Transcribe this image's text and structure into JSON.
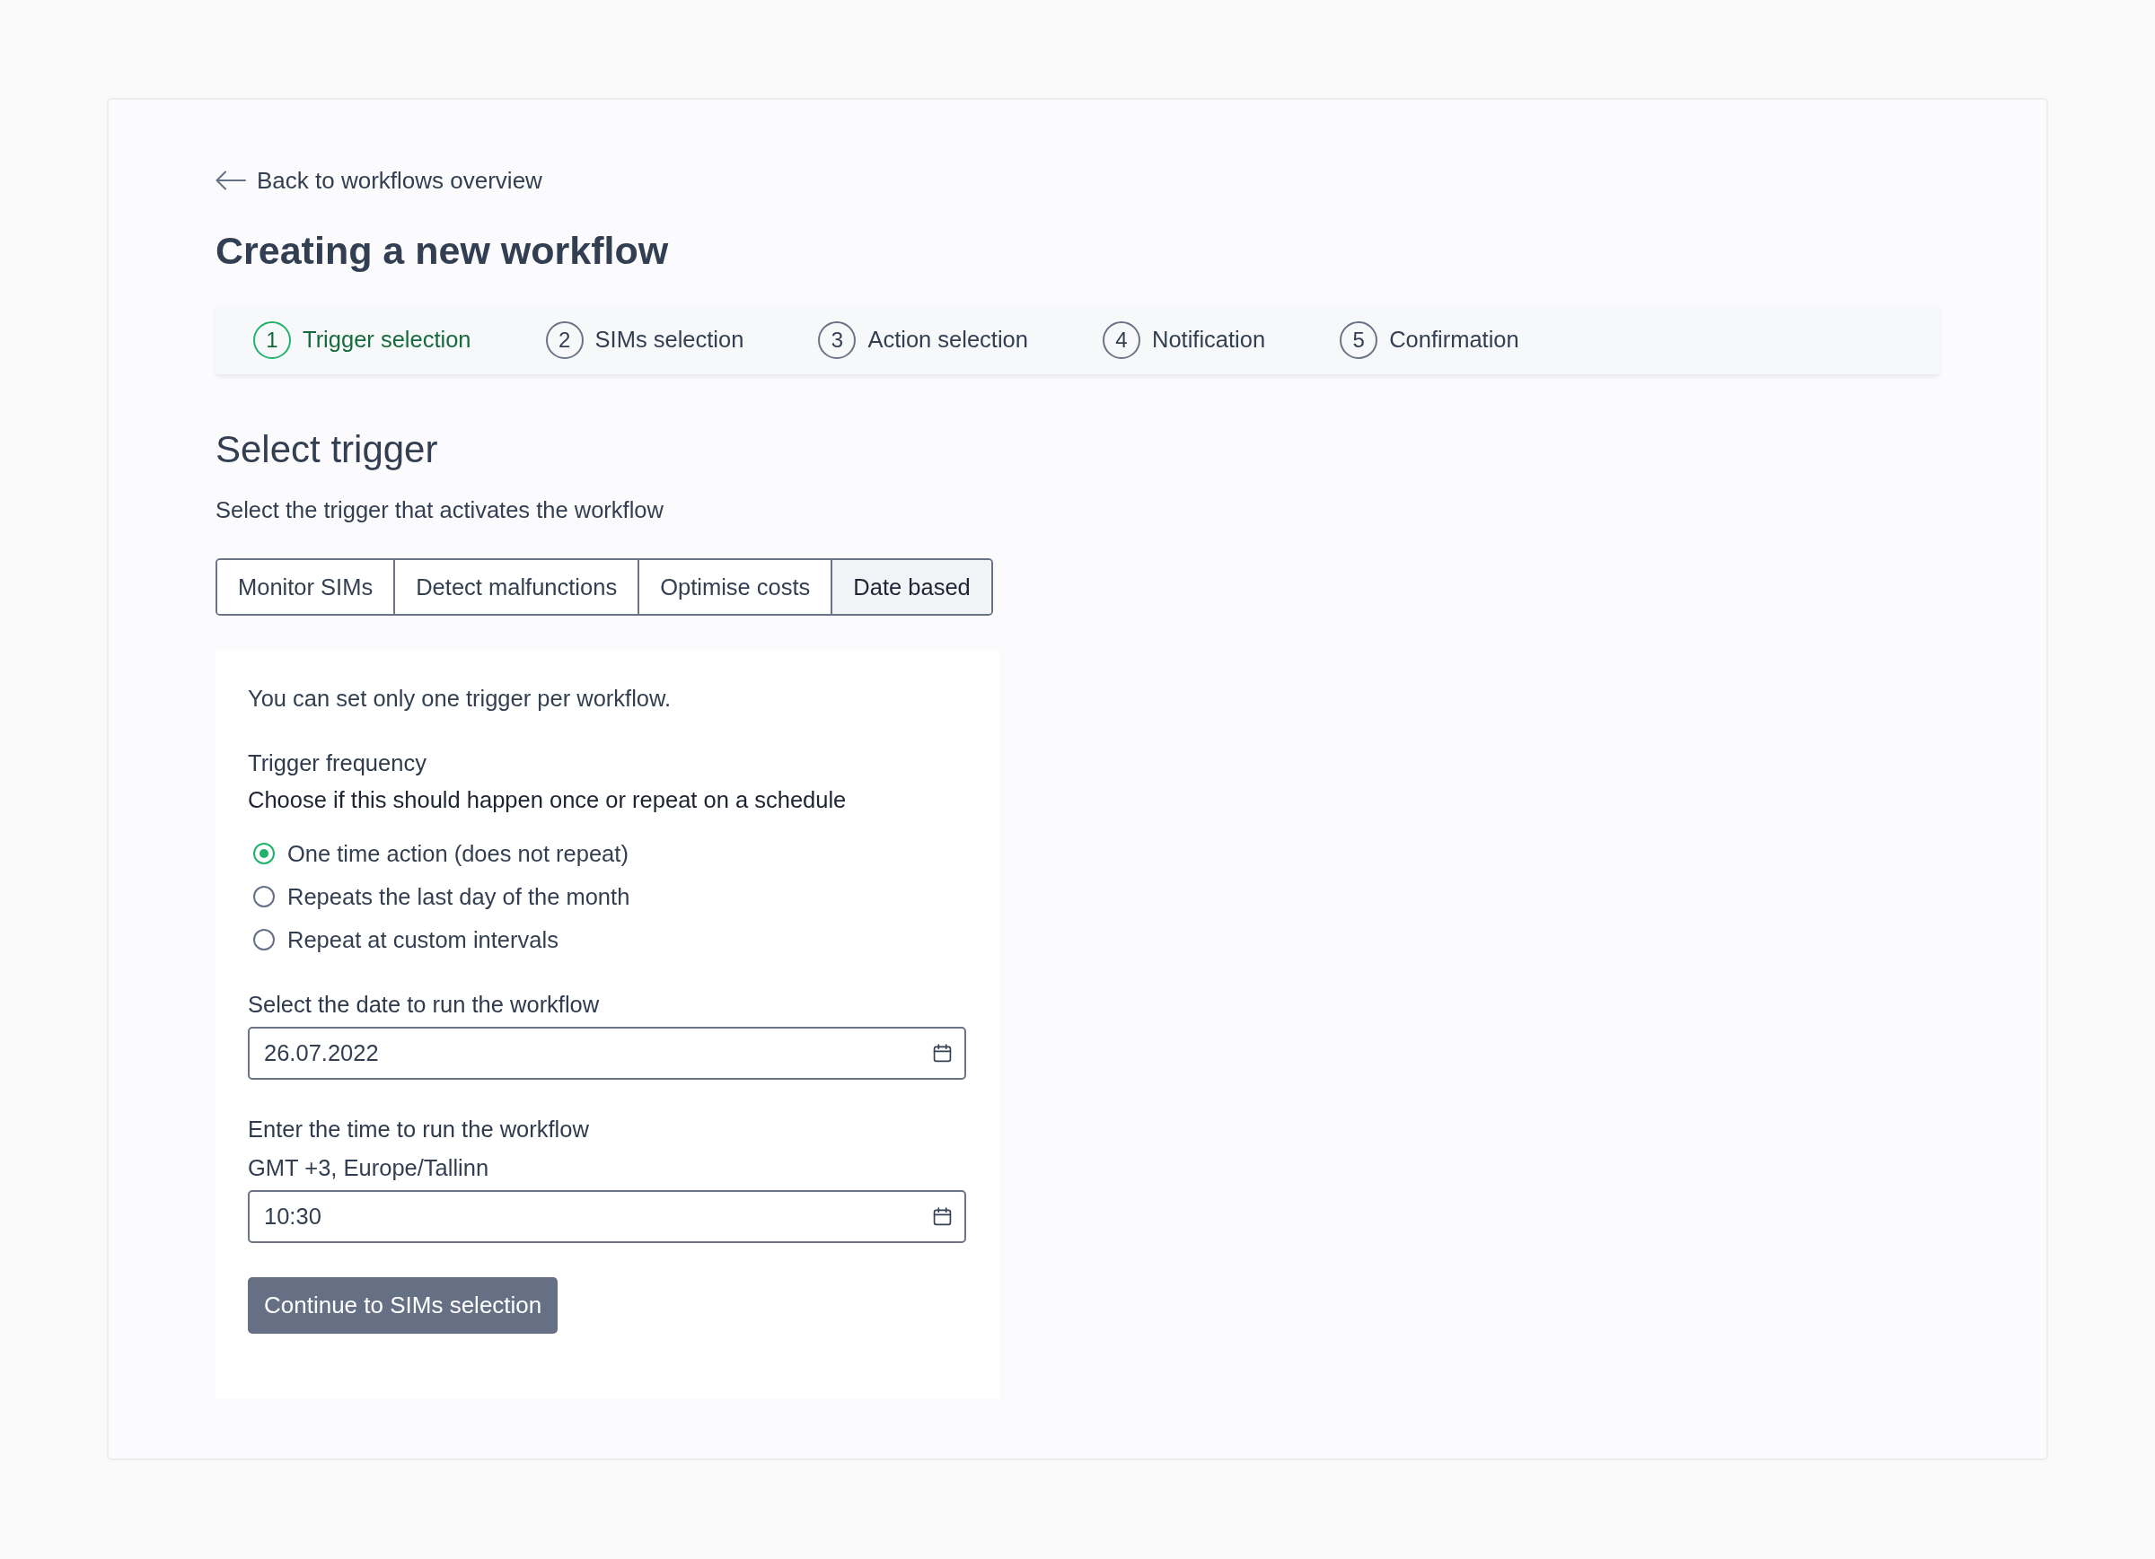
{
  "back_link": {
    "label": "Back to workflows overview"
  },
  "title": "Creating a new workflow",
  "steps": [
    {
      "number": "1",
      "label": "Trigger selection",
      "selected": true
    },
    {
      "number": "2",
      "label": "SIMs selection",
      "selected": false
    },
    {
      "number": "3",
      "label": "Action selection",
      "selected": false
    },
    {
      "number": "4",
      "label": "Notification",
      "selected": false
    },
    {
      "number": "5",
      "label": "Confirmation",
      "selected": false
    }
  ],
  "section": {
    "title": "Select trigger",
    "description": "Select the trigger that activates the workflow"
  },
  "trigger_tabs": [
    {
      "label": "Monitor SIMs",
      "selected": false
    },
    {
      "label": "Detect malfunctions",
      "selected": false
    },
    {
      "label": "Optimise costs",
      "selected": false
    },
    {
      "label": "Date based",
      "selected": true
    }
  ],
  "panel": {
    "note": "You can set only one trigger per workflow.",
    "frequency": {
      "label": "Trigger frequency",
      "hint": "Choose if this should happen once or repeat on a schedule",
      "options": [
        {
          "label": "One time action (does not repeat)",
          "selected": true
        },
        {
          "label": "Repeats the last day of the month",
          "selected": false
        },
        {
          "label": "Repeat at custom intervals",
          "selected": false
        }
      ]
    },
    "date_field": {
      "label": "Select the date to run the workflow",
      "value": "26.07.2022"
    },
    "time_field": {
      "label": "Enter the time to run the workflow",
      "hint": "GMT +3, Europe/Tallinn",
      "value": "10:30"
    },
    "button": {
      "label": "Continue to SIMs selection"
    }
  }
}
